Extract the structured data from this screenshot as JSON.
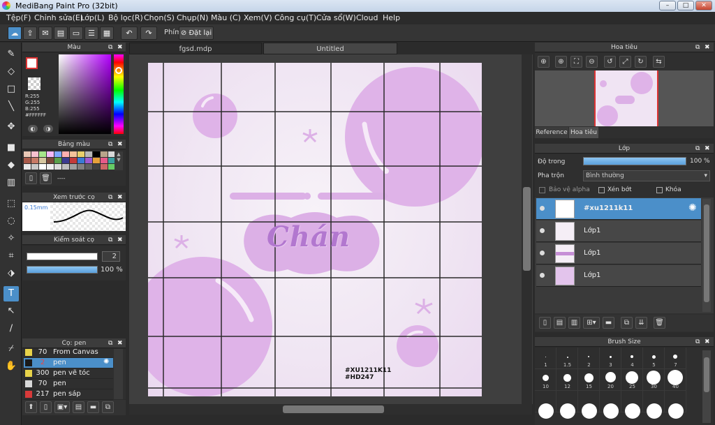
{
  "window": {
    "title": "MediBang Paint Pro (32bit)",
    "min": "–",
    "max": "□",
    "close": "✕"
  },
  "menu": [
    "Tệp(F)",
    "Chỉnh sửa(E)",
    "Lớp(L)",
    "Bộ lọc(R)",
    "Chọn(S)",
    "Chụp(N)",
    "Màu (C)",
    "Xem(V)",
    "Công cụ(T)",
    "Cửa sổ(W)",
    "Cloud",
    "Help"
  ],
  "toolbar": {
    "shortcut_label": "Phím",
    "reset_label": "Đặt lại"
  },
  "tabs": [
    "fgsd.mdp",
    "Untitled"
  ],
  "color_panel": {
    "title": "Màu",
    "r": "R:255",
    "g": "G:255",
    "b": "B:255",
    "hex": "#FFFFFF"
  },
  "palette_panel": {
    "title": "Bảng màu",
    "more": "----",
    "colors": [
      "#e9c7b5",
      "#f7c1cf",
      "#a6e68b",
      "#f4b8f7",
      "#7fa8ff",
      "#ffb0b0",
      "#f6c39a",
      "#e9d06b",
      "#b8b8b8",
      "#000000",
      "#b8a48a",
      "#d9d9d9",
      "#a85a4a",
      "#c77a66",
      "#d6c7a0",
      "#7b4a3a",
      "#5aa04b",
      "#3b3b8f",
      "#c43a3a",
      "#3a7bd5",
      "#9e5ad1",
      "#e6a13b",
      "#e65a8a",
      "#3aa0a0",
      "#e8e8e8",
      "#c8c8c8",
      "#ffffff",
      "#f0f0f0",
      "#dcdcdc",
      "#bfbfbf",
      "#a0a0a0",
      "#808080",
      "#606060",
      "#404040",
      "#cc6666",
      "#66cc66"
    ]
  },
  "preview_panel": {
    "title": "Xem trước cọ",
    "size": "0.15mm"
  },
  "brush_ctrl": {
    "title": "Kiểm soát cọ",
    "size_value": "2",
    "opacity_value": "100 %"
  },
  "brush_panel": {
    "title": "Cọ: pen",
    "items": [
      {
        "size": "70",
        "name": "From Canvas",
        "color": "#e8d34a"
      },
      {
        "size": "2",
        "name": "pen",
        "color": "#1a1a1a"
      },
      {
        "size": "300",
        "name": "pen vẽ tóc",
        "color": "#e8d34a"
      },
      {
        "size": "70",
        "name": "pen",
        "color": "#d8d8d8"
      },
      {
        "size": "217",
        "name": "pen sáp",
        "color": "#d83a3a"
      }
    ]
  },
  "navigator": {
    "title": "Hoa tiêu",
    "tab_reference": "Reference",
    "tab_navigator": "Hoa tiêu"
  },
  "layer_panel": {
    "title": "Lớp",
    "opacity_label": "Độ trong",
    "opacity_value": "100 %",
    "blend_label": "Pha trộn",
    "blend_value": "Bình thường",
    "protect_alpha": "Bảo vệ alpha",
    "clipping": "Xén bớt",
    "lock": "Khóa",
    "layers": [
      {
        "name": "#xu1211k11",
        "selected": true
      },
      {
        "name": "Lớp1",
        "selected": false
      },
      {
        "name": "Lớp1",
        "selected": false
      },
      {
        "name": "Lớp1",
        "selected": false
      }
    ]
  },
  "brush_size_panel": {
    "title": "Brush Size",
    "row1": [
      "1",
      "1.5",
      "2",
      "3",
      "4",
      "5",
      "7"
    ],
    "row2": [
      "10",
      "12",
      "15",
      "20",
      "25",
      "30",
      "40"
    ]
  },
  "artwork": {
    "headline": "Chán",
    "tag1": "#XU1211K11",
    "tag2": "#HD247"
  }
}
